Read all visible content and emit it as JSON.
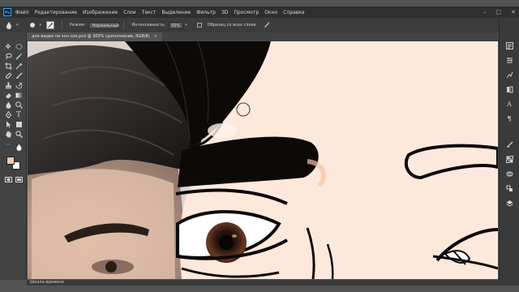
{
  "menu": {
    "logo": "Ps",
    "items": [
      "Файл",
      "Редактирование",
      "Изображение",
      "Слои",
      "Текст",
      "Выделение",
      "Фильтр",
      "3D",
      "Просмотр",
      "Окно",
      "Справка"
    ],
    "window_controls": [
      "–",
      "□",
      "✕"
    ]
  },
  "options": {
    "mode_label": "Режим:",
    "mode_value": "Нормальный",
    "strength_label": "Интенсивность:",
    "strength_value": "50%",
    "sample_all_label": "Образец со всех слоев"
  },
  "document": {
    "tab_title": "для видео ли чон сок.psd @ 300% (дополнение, RGB/8)",
    "tab_close": "✕"
  },
  "bottom_panel": {
    "tab_label": "Шкала времени"
  },
  "colors": {
    "foreground": "#f6c6a6",
    "background": "#ffffff",
    "skin_tone": "#fde9db",
    "hair": "#0d0907"
  },
  "icons": {
    "left_toolbar": [
      "move-icon",
      "marquee-icon",
      "lasso-icon",
      "magic-wand-icon",
      "crop-icon",
      "eyedropper-icon",
      "healing-brush-icon",
      "brush-icon",
      "clone-stamp-icon",
      "history-brush-icon",
      "eraser-icon",
      "gradient-icon",
      "blur-icon",
      "dodge-icon",
      "pen-icon",
      "type-icon",
      "path-selection-icon",
      "shape-icon",
      "hand-icon",
      "zoom-icon",
      "quick-mask-icon",
      "screen-mode-icon"
    ],
    "right_panel": [
      "history-icon",
      "properties-icon",
      "adjustments-icon",
      "libraries-icon",
      "character-icon",
      "paragraph-icon",
      "brush-settings-icon",
      "swatches-icon",
      "channels-icon",
      "paths-icon",
      "layers-icon"
    ]
  }
}
